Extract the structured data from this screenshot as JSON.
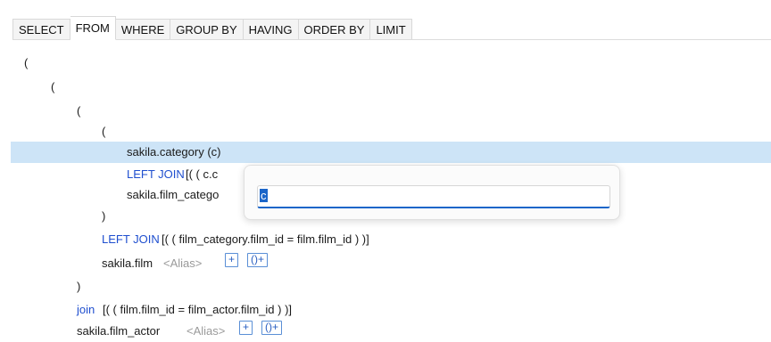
{
  "tabs": [
    "SELECT",
    "FROM",
    "WHERE",
    "GROUP BY",
    "HAVING",
    "ORDER BY",
    "LIMIT"
  ],
  "active_tab": "FROM",
  "code": {
    "l1": "(",
    "l2": "(",
    "l3": "(",
    "l4": "(",
    "l5_table": "sakila.category (c)",
    "l6_kw": "LEFT JOIN",
    "l6_rest": "[( ( c.c",
    "l7_table": "sakila.film_catego",
    "l8": ")",
    "l9_kw": "LEFT JOIN",
    "l9_rest": "[( ( film_category.film_id = film.film_id ) )]",
    "l10_table": "sakila.film",
    "l10_alias": "<Alias>",
    "l11": ")",
    "l12_kw": "join",
    "l12_rest": "[( ( film.film_id = film_actor.film_id ) )]",
    "l13_table": "sakila.film_actor",
    "l13_alias": "<Alias>"
  },
  "buttons": {
    "add": "+",
    "add_paren": "()+"
  },
  "popup": {
    "value": "c"
  },
  "colors": {
    "keyword": "#1f4fcf",
    "selection": "#cde4f7",
    "accent": "#1b66c9"
  }
}
